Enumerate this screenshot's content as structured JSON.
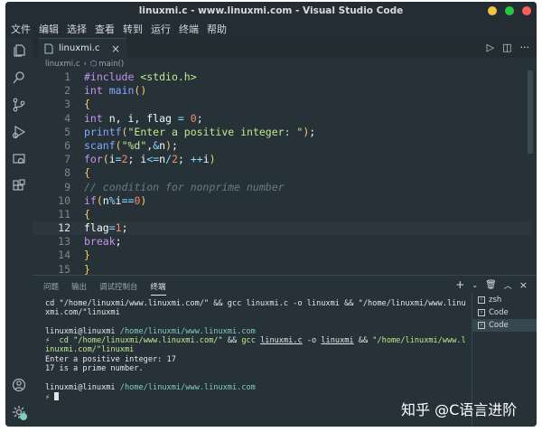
{
  "window": {
    "title": "linuxmi.c - www.linuxmi.com - Visual Studio Code",
    "controls_colors": [
      "#f5c242",
      "#27c93f",
      "#ff5f56"
    ]
  },
  "menu": [
    "文件",
    "编辑",
    "选择",
    "查看",
    "转到",
    "运行",
    "终端",
    "帮助"
  ],
  "activity_icons": [
    "files-icon",
    "search-icon",
    "source-control-icon",
    "run-debug-icon",
    "remote-explorer-icon",
    "extensions-icon",
    "account-icon",
    "settings-gear-icon"
  ],
  "tab": {
    "label": "linuxmi.c",
    "close": "×"
  },
  "breadcrumb": {
    "file": "linuxmi.c",
    "symbol": "main()"
  },
  "code": {
    "line_numbers": [
      "1",
      "2",
      "3",
      "4",
      "5",
      "6",
      "7",
      "8",
      "9",
      "10",
      "11",
      "12",
      "13",
      "14",
      "15"
    ],
    "active_line": 12,
    "lines": [
      "#include <stdio.h>",
      "int main()",
      "{",
      "int n, i, flag = 0;",
      "printf(\"Enter a positive integer: \");",
      "scanf(\"%d\",&n);",
      "for(i=2; i<=n/2; ++i)",
      "{",
      "// condition for nonprime number",
      "if(n%i==0)",
      "{",
      "flag=1;",
      "break;",
      "}",
      "}"
    ]
  },
  "panel": {
    "tabs": [
      "问题",
      "输出",
      "调试控制台",
      "终端"
    ],
    "active_tab": "终端",
    "terminal": {
      "lines": [
        "cd \"/home/linuxmi/www.linuxmi.com/\" && gcc linuxmi.c -o linuxmi && \"/home/linuxmi/www.linu",
        "xmi.com/\"linuxmi",
        "",
        "linuxmi@linuxmi /home/linuxmi/www.linuxmi.com",
        "⚡ cd \"/home/linuxmi/www.linuxmi.com/\" && gcc linuxmi.c -o linuxmi && \"/home/linuxmi/www.l",
        "inuxmi.com/\"linuxmi",
        "Enter a positive integer: 17",
        "17 is a prime number.",
        "",
        "linuxmi@linuxmi /home/linuxmi/www.linuxmi.com",
        "⚡"
      ]
    },
    "term_list": [
      "zsh",
      "Code",
      "Code"
    ]
  },
  "watermark": "知乎 @C语言进阶"
}
